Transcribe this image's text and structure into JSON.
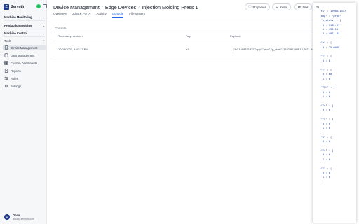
{
  "sidebar": {
    "brand": "Zerynth",
    "sections": [
      {
        "label": "Machine Monitoring"
      },
      {
        "label": "Production Insights"
      },
      {
        "label": "Machine Control"
      },
      {
        "label": "Tools"
      }
    ],
    "items": [
      {
        "label": "Device Management",
        "icon": "device-icon"
      },
      {
        "label": "Data Management",
        "icon": "database-icon"
      },
      {
        "label": "Custom Dashboards",
        "icon": "dashboard-icon"
      },
      {
        "label": "Reports",
        "icon": "report-icon"
      },
      {
        "label": "Rules",
        "icon": "rules-icon"
      },
      {
        "label": "Settings",
        "icon": "gear-icon"
      }
    ],
    "user": {
      "initial": "D",
      "name": "Doca",
      "email": "doca@zerynth.com"
    }
  },
  "header": {
    "crumbs": [
      "Device Management",
      "Edge Devices",
      "Injection Molding Press 1"
    ],
    "buttons": {
      "properties": "Properties",
      "reset": "Reset",
      "jobs": "Jobs"
    }
  },
  "tabs": [
    "Overview",
    "Jobs & FOTA",
    "Activity",
    "Console",
    "File system"
  ],
  "console": {
    "title": "Console",
    "columns": {
      "timestamp": "Timestamp device ↓",
      "tag": "Tag",
      "payload": "Payload"
    },
    "rows": [
      {
        "timestamp": "10/26/2023, 4:42:17 PM",
        "tag": "e1",
        "payload": "{\"ts\":1698331337,\"app\":\"prod\",\"p_stats\":[1182.97,498.15,4071.84]"
      }
    ]
  },
  "json_view": [
    "▾{",
    "  \"ts\" : 1698331337",
    "  \"app\" : \"prod\"",
    "  ▾\"p_stats\" : [",
    "    0 : 1182.97",
    "    1 : 498.15",
    "    2 : 4071.84",
    "  ]",
    "  ▾\"e\" : [",
    "    0 : 25.0030",
    "  ]",
    "  ▾\"t\" : [",
    "    0 : 0",
    "  ]",
    "  ▾\"T\" : [",
    "    0 : 60",
    "    1 : 0",
    "  ]",
    "  ▾\"TPh\" : [",
    "    0 : 0",
    "    1 : 0",
    "  ]",
    "  ▾\"Sv\" : [",
    "    0 : 0",
    "  ]",
    "  ▾\"Fx\" : [",
    "    0 : 0",
    "    1 : 0",
    "  ]",
    "  ▾\"R\" : [",
    "    0 : 0",
    "  ]",
    "  ▾\"FA\" : [",
    "    0 : 0",
    "    1 : 0",
    "  ]",
    "  ▾\"E\" : [",
    "    0 : 0",
    "    1 : 0",
    "  ]"
  ],
  "colors": {
    "accent": "#2563eb",
    "brand": "#1e3a8a",
    "online": "#22c55e"
  }
}
